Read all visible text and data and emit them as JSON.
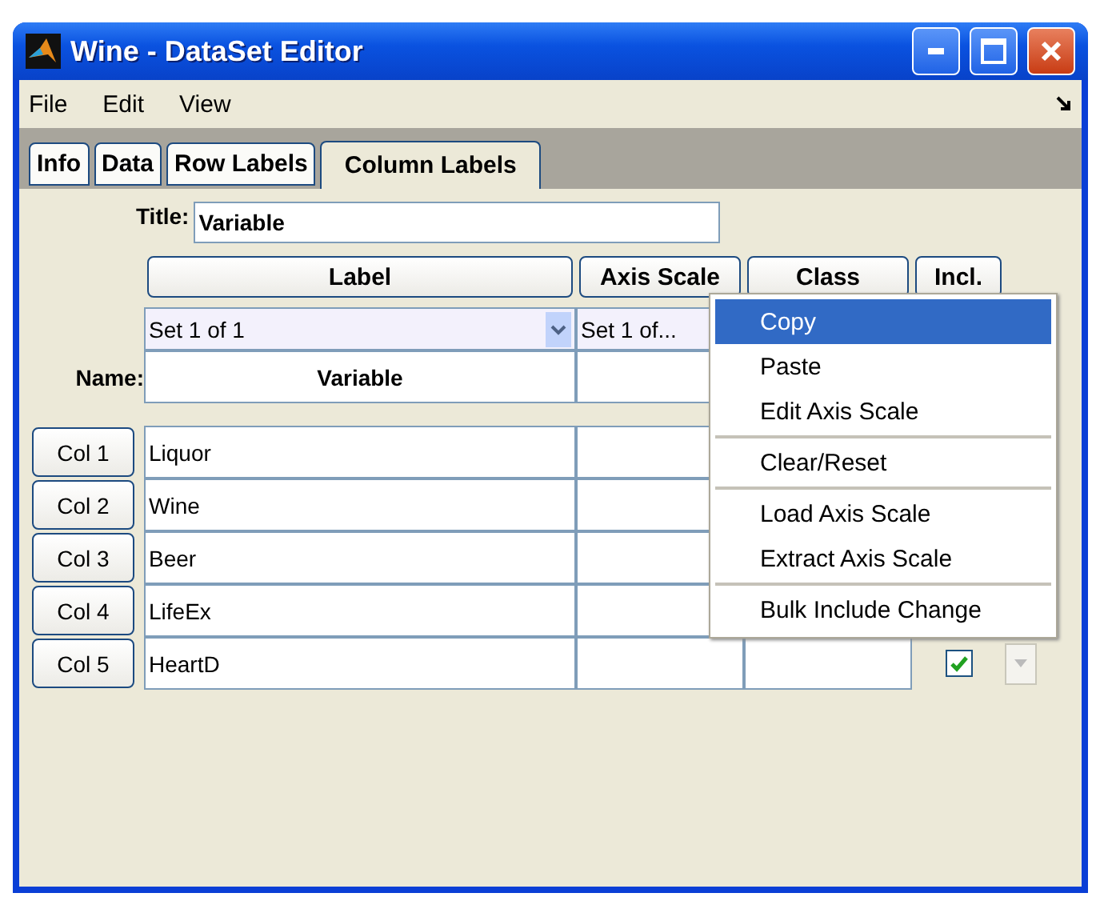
{
  "window": {
    "title": "Wine - DataSet Editor"
  },
  "menubar": [
    "File",
    "Edit",
    "View"
  ],
  "tabs": [
    {
      "label": "Info",
      "selected": false
    },
    {
      "label": "Data",
      "selected": false
    },
    {
      "label": "Row Labels",
      "selected": false
    },
    {
      "label": "Column Labels",
      "selected": true
    }
  ],
  "title_field": {
    "label": "Title:",
    "value": "Variable"
  },
  "headers": [
    "Label",
    "Axis Scale",
    "Class",
    "Incl."
  ],
  "set_selectors": [
    "Set 1 of 1",
    "Set 1 of..."
  ],
  "name_row": {
    "label": "Name:",
    "value": "Variable"
  },
  "rows": [
    {
      "button": "Col 1",
      "label": "Liquor"
    },
    {
      "button": "Col 2",
      "label": "Wine"
    },
    {
      "button": "Col 3",
      "label": "Beer"
    },
    {
      "button": "Col 4",
      "label": "LifeEx"
    },
    {
      "button": "Col 5",
      "label": "HeartD",
      "included": true
    }
  ],
  "context_menu": {
    "groups": [
      [
        {
          "label": "Copy",
          "selected": true
        },
        {
          "label": "Paste",
          "selected": false
        },
        {
          "label": "Edit Axis Scale",
          "selected": false
        }
      ],
      [
        {
          "label": "Clear/Reset",
          "selected": false
        }
      ],
      [
        {
          "label": "Load Axis Scale",
          "selected": false
        },
        {
          "label": "Extract Axis Scale",
          "selected": false
        }
      ],
      [
        {
          "label": "Bulk Include Change",
          "selected": false
        }
      ]
    ]
  }
}
